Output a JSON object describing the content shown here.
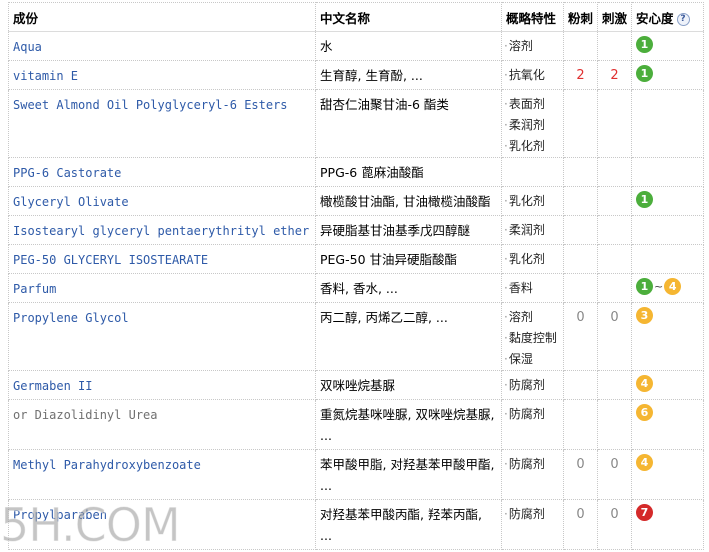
{
  "table": {
    "headers": {
      "name": "成份",
      "cn_name": "中文名称",
      "function": "概略特性",
      "acne": "粉刺",
      "irritation": "刺激",
      "safety": "安心度"
    },
    "help_icon": "?",
    "badge_colors": {
      "green": "#4cae3c",
      "orange": "#f5b632",
      "red": "#d42a2a"
    },
    "rows": [
      {
        "name": "Aqua",
        "cn": "水",
        "functions": [
          "溶剂"
        ],
        "acne": "",
        "irritation": "",
        "safety": "1"
      },
      {
        "name": "vitamin E",
        "cn": "生育醇, 生育酚, ...",
        "functions": [
          "抗氧化"
        ],
        "acne": "2",
        "irritation": "2",
        "safety": "1"
      },
      {
        "name": "Sweet Almond Oil Polyglyceryl-6 Esters",
        "cn": "甜杏仁油聚甘油-6 酯类",
        "functions": [
          "表面剂",
          "柔润剂",
          "乳化剂"
        ],
        "acne": "",
        "irritation": "",
        "safety": ""
      },
      {
        "name": "PPG-6 Castorate",
        "cn": "PPG-6 蓖麻油酸酯",
        "functions": [],
        "acne": "",
        "irritation": "",
        "safety": ""
      },
      {
        "name": "Glyceryl Olivate",
        "cn": "橄榄酸甘油酯, 甘油橄榄油酸酯",
        "functions": [
          "乳化剂"
        ],
        "acne": "",
        "irritation": "",
        "safety": "1"
      },
      {
        "name": "Isostearyl glyceryl pentaerythrityl ether",
        "cn": "异硬脂基甘油基季戊四醇醚",
        "functions": [
          "柔润剂"
        ],
        "acne": "",
        "irritation": "",
        "safety": ""
      },
      {
        "name": "PEG-50 GLYCERYL ISOSTEARATE",
        "cn": "PEG-50 甘油异硬脂酸酯",
        "functions": [
          "乳化剂"
        ],
        "acne": "",
        "irritation": "",
        "safety": ""
      },
      {
        "name": "Parfum",
        "cn": "香料, 香水, ...",
        "functions": [
          "香料"
        ],
        "acne": "",
        "irritation": "",
        "safety": "1",
        "safety_to": "4",
        "range_sep": "~"
      },
      {
        "name": "Propylene Glycol",
        "cn": "丙二醇, 丙烯乙二醇, ...",
        "functions": [
          "溶剂",
          "黏度控制",
          "保湿"
        ],
        "acne": "0",
        "irritation": "0",
        "safety": "3"
      },
      {
        "name": "Germaben II",
        "cn": "双咪唑烷基脲",
        "functions": [
          "防腐剂"
        ],
        "acne": "",
        "irritation": "",
        "safety": "4"
      },
      {
        "name": "or Diazolidinyl Urea",
        "cn": "重氮烷基咪唑脲, 双咪唑烷基脲, ...",
        "functions": [
          "防腐剂"
        ],
        "acne": "",
        "irritation": "",
        "safety": "6"
      },
      {
        "name": "Methyl Parahydroxybenzoate",
        "cn": "苯甲酸甲脂, 对羟基苯甲酸甲酯, ...",
        "functions": [
          "防腐剂"
        ],
        "acne": "0",
        "irritation": "0",
        "safety": "4"
      },
      {
        "name": "Propylparaben",
        "cn": "对羟基苯甲酸丙酯, 羟苯丙酯, ...",
        "functions": [
          "防腐剂"
        ],
        "acne": "0",
        "irritation": "0",
        "safety": "7"
      }
    ]
  },
  "watermark": "5H.COM"
}
